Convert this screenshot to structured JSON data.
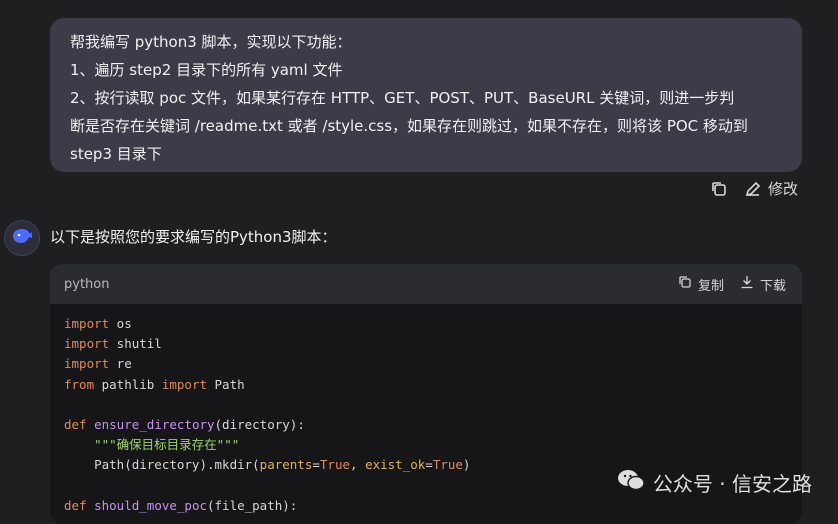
{
  "user_message": {
    "lines": [
      "帮我编写 python3 脚本，实现以下功能：",
      "1、遍历 step2 目录下的所有 yaml 文件",
      "2、按行读取 poc 文件，如果某行存在  HTTP、GET、POST、PUT、BaseURL 关键词，则进一步判",
      "断是否存在关键词 /readme.txt 或者 /style.css，如果存在则跳过，如果不存在，则将该 POC 移动到",
      "step3 目录下"
    ]
  },
  "message_actions": {
    "copy_icon": "copy-icon",
    "edit_label": "修改"
  },
  "assistant": {
    "avatar_icon": "whale-logo-icon",
    "intro": "以下是按照您的要求编写的Python3脚本："
  },
  "code_block": {
    "language": "python",
    "copy_label": "复制",
    "download_label": "下载",
    "lines": [
      "import os",
      "import shutil",
      "import re",
      "from pathlib import Path",
      "",
      "def ensure_directory(directory):",
      "    \"\"\"确保目标目录存在\"\"\"",
      "    Path(directory).mkdir(parents=True, exist_ok=True)",
      "",
      "def should_move_poc(file_path):"
    ]
  },
  "watermark": {
    "text": "公众号 · 信安之路",
    "icon": "wechat-icon"
  },
  "colors": {
    "background": "#1f1f22",
    "bubble": "#3b3c47",
    "code_bg": "#161618",
    "keyword": "#e08a5d",
    "function": "#c792ea",
    "string": "#9fd36b",
    "param": "#e0b15a"
  }
}
